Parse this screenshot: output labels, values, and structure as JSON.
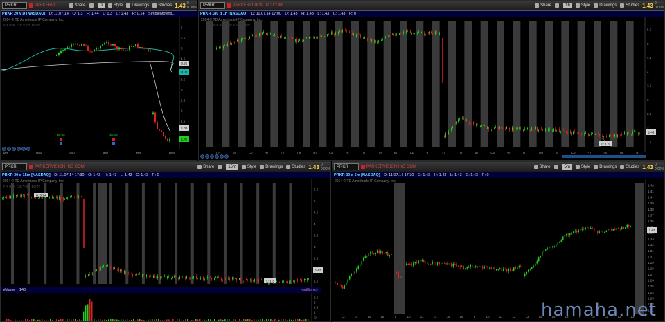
{
  "common": {
    "symbol": "PRKR",
    "share": "Share",
    "style": "Style",
    "drawings": "Drawings",
    "studies": "Studies",
    "price": "1.43",
    "change_top": "0",
    "change_bottom": "0.00%",
    "company": "PARKERVISION INC COM",
    "copyright": "2014 © TD Ameritrade IP Company, Inc.",
    "logo": "PARKERVISION",
    "colors": {
      "up": "#22cc22",
      "down": "#dd2222",
      "bg": "#000000",
      "info_bg": "#00003a",
      "price": "#ffd24d"
    }
  },
  "panel1": {
    "company": "PARKERVI...",
    "period": "D",
    "info": {
      "title": "PRKR 20 y D [NASDAQ]",
      "d": "D: 11.07.14",
      "o": "O: 1.3",
      "h": "H: 1.44",
      "l": "L: 1.3",
      "c": "C: 1.43",
      "r": "R: 0.14",
      "study": "SimpleMoving..."
    },
    "months": [
      "фев",
      "мар",
      "апр",
      "май",
      "июн",
      "июл"
    ],
    "y_labels": [
      "6",
      "5.5",
      "5",
      "4.5",
      "4",
      "3.5",
      "3",
      "2.5",
      "2",
      "1.5"
    ],
    "badges": [
      "3.35",
      "3.07",
      "1.83",
      "1.42"
    ],
    "dividend_labels": [
      "$0.08",
      "$0.06"
    ]
  },
  "panel2": {
    "period": "1h",
    "info": {
      "title": "PRKR 180 d 1h [NASDAQ]",
      "d": "D: 11.07.14 17:00",
      "o": "O: 1.43",
      "h": "H: 1.43",
      "l": "L: 1.43",
      "c": "C: 1.43",
      "r": "R: 0"
    },
    "days": [
      "Пн",
      "Вт",
      "Ср",
      "Чт",
      "Пт"
    ],
    "y_labels": [
      "5.5",
      "5",
      "4.5",
      "4",
      "3.5",
      "3",
      "2.5",
      "2",
      "1.5"
    ],
    "price_badge": "1.43",
    "low_marker": "L: 1.3"
  },
  "panel3": {
    "period": "15m",
    "info": {
      "title": "PRKR 30 d 15m [NASDAQ]",
      "d": "D: 11.07.14 17:30",
      "o": "O: 1.43",
      "h": "H: 1.43",
      "l": "L: 1.43",
      "c": "C: 1.43",
      "r": "R: 0"
    },
    "high_marker": "H: 5.24",
    "low_marker": "L: 1.3",
    "price_badge": "1.43",
    "volume": {
      "label": "Volume",
      "value": "140",
      "units": "<millions>",
      "y_labels": [
        "2.5",
        "2",
        "1.5",
        "1",
        ".5"
      ]
    },
    "days": [
      "Пн",
      "Вт",
      "Ср",
      "Чт",
      "Пт"
    ],
    "y_labels": [
      "5.5",
      "5",
      "4.5",
      "4",
      "3.5",
      "3",
      "2.5",
      "2",
      "1.5"
    ]
  },
  "panel4": {
    "period": "5m",
    "info": {
      "title": "PRKR 20 d 5m [NASDAQ]",
      "d": "D: 11.07.14 17:30",
      "o": "O: 1.43",
      "h": "H: 1.43",
      "l": "L: 1.43",
      "c": "C: 1.43",
      "r": "R: 0"
    },
    "x_labels": [
      "13",
      "14",
      "15",
      "16",
      "9",
      "10",
      "11",
      "14",
      "15",
      "16",
      "9",
      "10",
      "11",
      "12",
      "13",
      "14",
      "15",
      "16",
      "9",
      "10",
      "11",
      "12",
      "13"
    ],
    "y_labels": [
      "1.42",
      "1.41",
      "1.4",
      "1.39",
      "1.38",
      "1.37",
      "1.36",
      "1.35",
      "1.34",
      "1.33",
      "1.32",
      "1.31",
      "1.3",
      "1.29",
      "1.28",
      "1.27",
      "1.26",
      "1.25",
      "1.24",
      "1.23",
      "1.22",
      "1.21"
    ],
    "price_badge": "1.43"
  },
  "watermark": "hamaha.net"
}
